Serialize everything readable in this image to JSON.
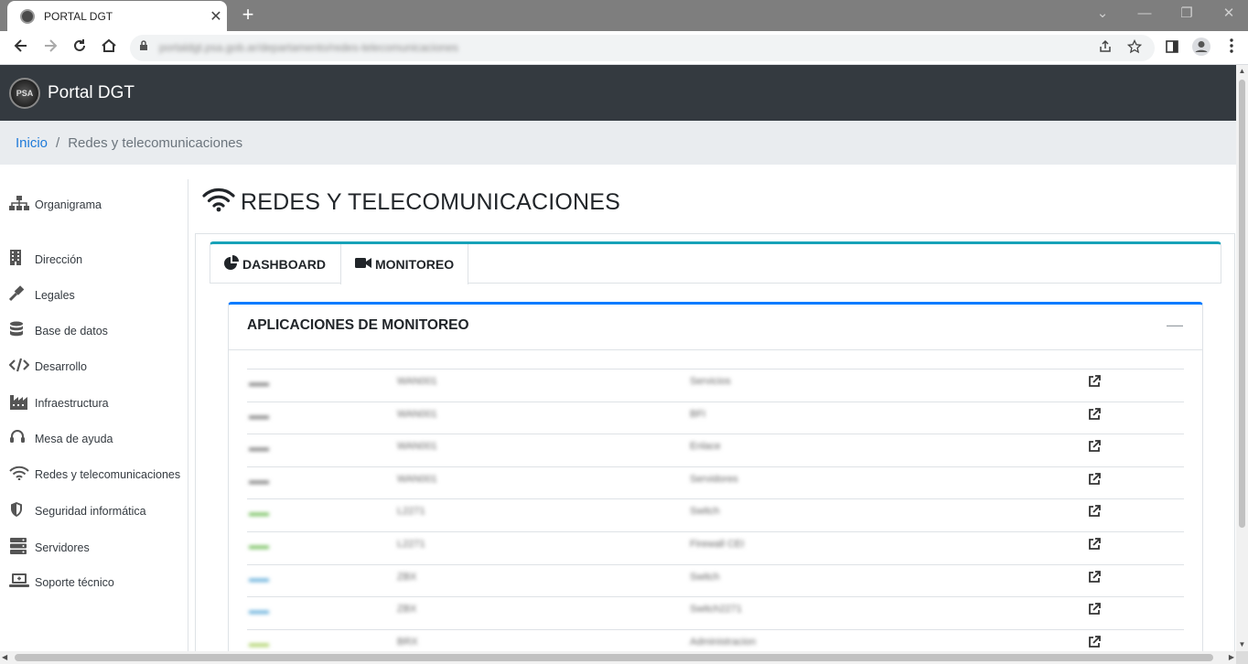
{
  "browser": {
    "tab_title": "PORTAL DGT",
    "tab_close": "✕",
    "new_tab": "+",
    "url": "portaldgt.psa.gob.ar/departamento/redes-telecomunicaciones",
    "window_controls": [
      "⌄",
      "—",
      "❐",
      "✕"
    ]
  },
  "navbar": {
    "logo_text": "PSA",
    "brand": "Portal DGT"
  },
  "breadcrumb": {
    "home": "Inicio",
    "separator": "/",
    "current": "Redes y telecomunicaciones"
  },
  "sidebar": {
    "items": [
      {
        "label": "Organigrama",
        "icon": "sitemap-icon"
      },
      {
        "label": "Dirección",
        "icon": "building-icon"
      },
      {
        "label": "Legales",
        "icon": "gavel-icon"
      },
      {
        "label": "Base de datos",
        "icon": "database-icon"
      },
      {
        "label": "Desarrollo",
        "icon": "code-icon"
      },
      {
        "label": "Infraestructura",
        "icon": "industry-icon"
      },
      {
        "label": "Mesa de ayuda",
        "icon": "headset-icon"
      },
      {
        "label": "Redes y telecomunicaciones",
        "icon": "wifi-icon"
      },
      {
        "label": "Seguridad informática",
        "icon": "shield-icon"
      },
      {
        "label": "Servidores",
        "icon": "server-icon"
      },
      {
        "label": "Soporte técnico",
        "icon": "laptop-icon"
      }
    ]
  },
  "main": {
    "title": "REDES Y TELECOMUNICACIONES",
    "tabs": [
      {
        "label": "DASHBOARD",
        "icon": "chart-pie-icon",
        "active": false
      },
      {
        "label": "MONITOREO",
        "icon": "video-icon",
        "active": true
      }
    ],
    "card": {
      "title": "APLICACIONES DE MONITOREO",
      "collapse": "—"
    },
    "rows": [
      {
        "c1": "▬▬",
        "c2": "WAN001",
        "c3": "Servicios"
      },
      {
        "c1": "▬▬",
        "c2": "WAN001",
        "c3": "BFI"
      },
      {
        "c1": "▬▬",
        "c2": "WAN001",
        "c3": "Enlace"
      },
      {
        "c1": "▬▬",
        "c2": "WAN001",
        "c3": "Servidores"
      },
      {
        "c1": "▬▬",
        "c2": "L2271",
        "c3": "Switch"
      },
      {
        "c1": "▬▬",
        "c2": "L2271",
        "c3": "Firewall CEI"
      },
      {
        "c1": "▬▬",
        "c2": "ZBX",
        "c3": "Switch"
      },
      {
        "c1": "▬▬",
        "c2": "ZBX",
        "c3": "Switch2271"
      },
      {
        "c1": "▬▬",
        "c2": "BRX",
        "c3": "Administracion"
      }
    ]
  },
  "colors": {
    "navbar_bg": "#343a40",
    "tab_accent": "#17a2b8",
    "card_accent": "#007bff",
    "link": "#1e7ad9"
  }
}
